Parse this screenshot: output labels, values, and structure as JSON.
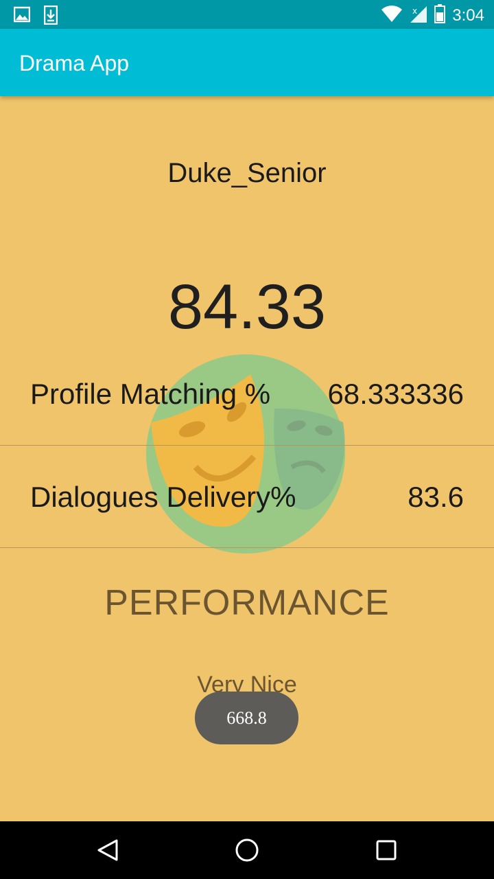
{
  "status_bar": {
    "time": "3:04",
    "icons": [
      "image-icon",
      "download-icon",
      "wifi-icon",
      "signal-icon",
      "battery-icon"
    ]
  },
  "app_bar": {
    "title": "Drama App"
  },
  "profile": {
    "name": "Duke_Senior",
    "score": "84.33"
  },
  "metrics": [
    {
      "label": "Profile Matching %",
      "value": "68.333336"
    },
    {
      "label": "Dialogues Delivery%",
      "value": "83.6"
    }
  ],
  "performance": {
    "title": "PERFORMANCE",
    "value": "Very Nice"
  },
  "toast": {
    "text": "668.8"
  },
  "colors": {
    "status_bar": "#0097A7",
    "app_bar": "#00BCD4",
    "background": "#EFC46A",
    "logo_circle": "#8BC98A",
    "logo_mask": "#F5B942",
    "toast": "#5E5C59"
  },
  "nav_bar": {
    "icons": [
      "back-icon",
      "home-icon",
      "recents-icon"
    ]
  }
}
